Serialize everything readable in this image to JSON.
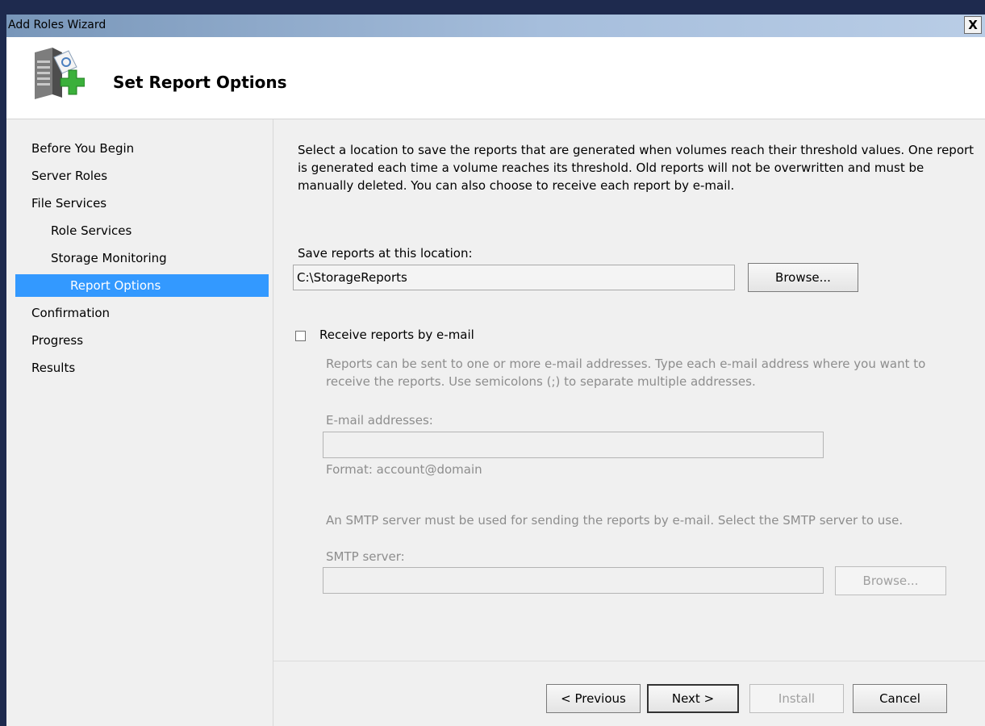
{
  "window": {
    "title": "Add Roles Wizard",
    "close_label": "X"
  },
  "header": {
    "title": "Set Report Options",
    "icon": "server-add-icon"
  },
  "nav": {
    "items": [
      {
        "label": "Before You Begin",
        "selected": false
      },
      {
        "label": "Server Roles",
        "selected": false
      },
      {
        "label": "File Services",
        "selected": false
      },
      {
        "label": "Role Services",
        "selected": false
      },
      {
        "label": "Storage Monitoring",
        "selected": false
      },
      {
        "label": "Report Options",
        "selected": true
      },
      {
        "label": "Confirmation",
        "selected": false
      },
      {
        "label": "Progress",
        "selected": false
      },
      {
        "label": "Results",
        "selected": false
      }
    ],
    "selected_color": "#3399ff"
  },
  "content": {
    "intro": "Select a location to save the reports that are generated when volumes reach their threshold values. One report is generated each time a volume reaches its threshold. Old reports will not be overwritten and must be manually deleted. You can also choose to receive each report by e-mail.",
    "save_label": "Save reports at this location:",
    "save_value": "C:\\StorageReports",
    "browse_label": "Browse...",
    "email_checkbox_label": "Receive reports by e-mail",
    "email_checked": false,
    "email_desc": "Reports can be sent to one or more e-mail addresses. Type each e-mail address where you want to receive the reports. Use semicolons (;) to separate multiple addresses.",
    "email_addresses_label": "E-mail addresses:",
    "email_addresses_value": "",
    "email_format": "Format: account@domain",
    "smtp_desc": "An SMTP server must be used for sending the reports by e-mail. Select the SMTP server to use.",
    "smtp_label": "SMTP server:",
    "smtp_value": "",
    "smtp_browse_label": "Browse..."
  },
  "footer": {
    "previous_label": "< Previous",
    "next_label": "Next >",
    "install_label": "Install",
    "cancel_label": "Cancel"
  }
}
